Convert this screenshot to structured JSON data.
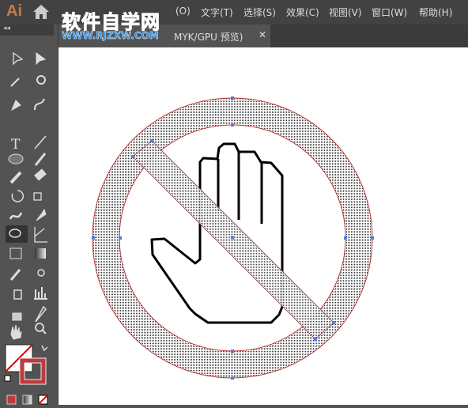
{
  "app": {
    "logo": "Ai"
  },
  "menu": [
    "文字(T)",
    "选择(S)",
    "效果(C)",
    "视图(V)",
    "窗口(W)",
    "帮助(H)"
  ],
  "partial_menu": "(O)",
  "watermark": {
    "title": "软件自学网",
    "url": "WWW.RJZXW.COM"
  },
  "document_tab": {
    "label": "MYK/GPU 预览)",
    "close": "✕"
  },
  "toolbar": {
    "collapse": "◂◂",
    "tools": [
      "selection",
      "direct-selection",
      "magic-wand",
      "lasso",
      "pen",
      "curvature",
      "type",
      "line-segment",
      "ellipse",
      "paintbrush",
      "pencil",
      "eraser",
      "rotate",
      "scale",
      "warp",
      "puppet-warp",
      "shape-builder",
      "perspective-grid",
      "mesh",
      "gradient",
      "eyedropper",
      "blend",
      "symbol-sprayer",
      "column-graph",
      "artboard",
      "slice",
      "hand",
      "zoom"
    ],
    "type_glyph": "T"
  },
  "colors": {
    "fill": "#ffffff",
    "stroke": "#c0393b",
    "accent": "#4a7de8"
  }
}
